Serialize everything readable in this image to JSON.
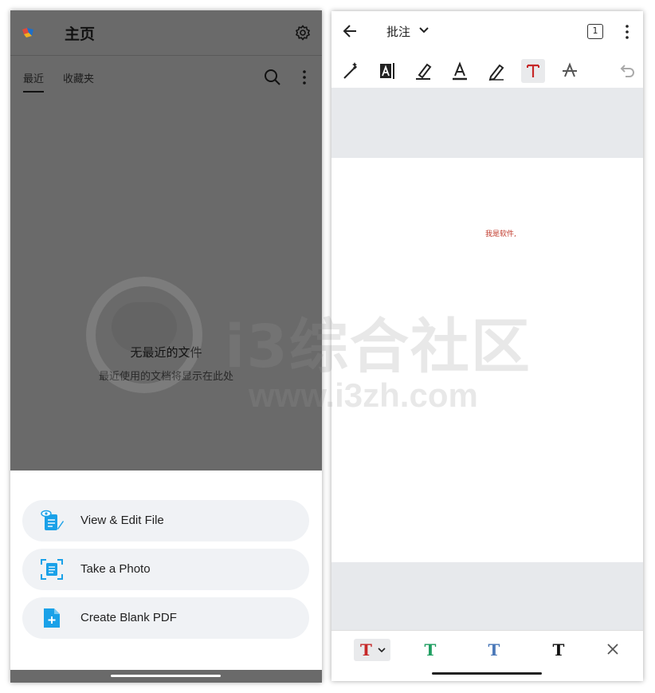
{
  "left": {
    "header": {
      "title": "主页"
    },
    "tabs": [
      {
        "label": "最近",
        "active": true
      },
      {
        "label": "收藏夹",
        "active": false
      }
    ],
    "empty_state": {
      "title": "无最近的文件",
      "subtitle": "最近使用的文档将显示在此处"
    },
    "sheet_actions": [
      {
        "label": "View & Edit File",
        "icon": "file-view-edit-icon"
      },
      {
        "label": "Take a Photo",
        "icon": "scan-document-icon"
      },
      {
        "label": "Create Blank PDF",
        "icon": "new-pdf-icon"
      }
    ]
  },
  "right": {
    "topbar": {
      "title": "批注",
      "page_count": "1"
    },
    "tools": [
      "magic-pen-icon",
      "text-box-icon",
      "highlighter-icon",
      "underline-icon",
      "pen-icon",
      "text-tool-icon",
      "strikethrough-icon",
      "undo-icon"
    ],
    "document": {
      "text": "我是软件,"
    },
    "text_colors": [
      {
        "glyph": "T",
        "color": "#c62828",
        "selected": true
      },
      {
        "glyph": "T",
        "color": "#1e9e60",
        "selected": false
      },
      {
        "glyph": "T",
        "color": "#4a78b8",
        "selected": false
      },
      {
        "glyph": "T",
        "color": "#111111",
        "selected": false
      }
    ]
  },
  "watermark": {
    "cn": "i3综合社区",
    "url": "www.i3zh.com"
  },
  "colors": {
    "accent": "#1aa1e8",
    "annotation_red": "#c62828",
    "dim_overlay": "#6a6a6a"
  }
}
